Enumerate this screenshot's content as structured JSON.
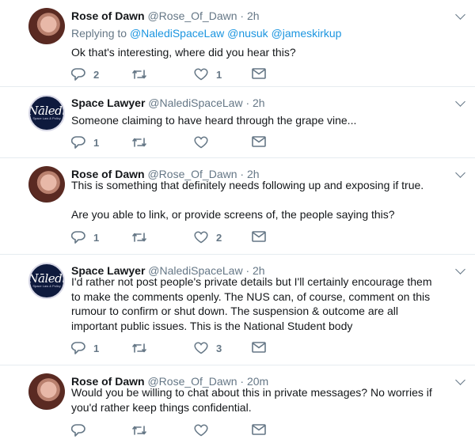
{
  "tweets": [
    {
      "name": "Rose of Dawn",
      "handle": "@Rose_Of_Dawn",
      "time": "· 2h",
      "replying_label": "Replying to",
      "replying_mentions": "@NalediSpaceLaw @nusuk @jameskirkup",
      "paragraphs": [
        "Ok that's interesting, where did you hear this?"
      ],
      "replies": "2",
      "retweets": "",
      "likes": "1"
    },
    {
      "name": "Space Lawyer",
      "handle": "@NalediSpaceLaw",
      "time": "· 2h",
      "avatar_text": "Nāledi",
      "avatar_subtext": "Space Law & Policy",
      "paragraphs": [
        "Someone claiming to have heard through the grape vine..."
      ],
      "replies": "1",
      "retweets": "",
      "likes": ""
    },
    {
      "name": "Rose of Dawn",
      "handle": "@Rose_Of_Dawn",
      "time": "· 2h",
      "paragraphs": [
        "This is something that definitely needs following up and exposing if true.",
        "Are you able to link, or provide screens of, the people saying this?"
      ],
      "replies": "1",
      "retweets": "",
      "likes": "2"
    },
    {
      "name": "Space Lawyer",
      "handle": "@NalediSpaceLaw",
      "time": "· 2h",
      "avatar_text": "Nāledi",
      "avatar_subtext": "Space Law & Policy",
      "paragraphs": [
        "I'd rather not post people's private details but I'll certainly encourage them to make the comments openly.  The NUS can, of course, comment on this rumour to confirm or shut down. The suspension & outcome are all important public issues. This is the National Student body"
      ],
      "replies": "1",
      "retweets": "",
      "likes": "3"
    },
    {
      "name": "Rose of Dawn",
      "handle": "@Rose_Of_Dawn",
      "time": "· 20m",
      "paragraphs": [
        "Would you be willing to chat about this in private messages? No worries if you'd rather keep things confidential."
      ],
      "replies": "",
      "retweets": "",
      "likes": ""
    }
  ],
  "colors": {
    "link": "#1b95e0",
    "muted": "#657786",
    "text": "#14171a",
    "divider": "#e6ecf0"
  },
  "icons": {
    "reply": "reply-icon",
    "retweet": "retweet-icon",
    "like": "heart-icon",
    "dm": "envelope-icon",
    "menu": "chevron-down-icon"
  }
}
